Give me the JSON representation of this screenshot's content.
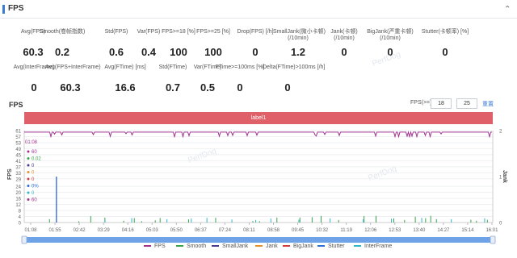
{
  "header": {
    "title": "FPS"
  },
  "stats_row1": [
    {
      "label": "Avg(FPS)",
      "value": "60.3"
    },
    {
      "label": "Smooth(卷帧指数)",
      "value": "0.2"
    },
    {
      "label": "Std(FPS)",
      "value": "0.6"
    },
    {
      "label": "Var(FPS)",
      "value": "0.4"
    },
    {
      "label": "FPS>=18 [%]",
      "value": "100"
    },
    {
      "label": "FPS>=25 [%]",
      "value": "100"
    },
    {
      "label": "Drop(FPS) [/h]",
      "value": "0"
    },
    {
      "label": "SmallJank(微小卡顿)",
      "label2": "(/10min)",
      "value": "1.2"
    },
    {
      "label": "Jank(卡顿)",
      "label2": "(/10min)",
      "value": "0"
    },
    {
      "label": "BigJank(严重卡顿)",
      "label2": "(/10min)",
      "value": "0"
    },
    {
      "label": "Stutter(卡顿率) [%]",
      "value": "0"
    }
  ],
  "stats_row2": [
    {
      "label": "Avg(InterFrame)",
      "value": "0"
    },
    {
      "label": "Avg(FPS+InterFrame)",
      "value": "60.3"
    },
    {
      "label": "Avg(FTime) [ms]",
      "value": "16.6"
    },
    {
      "label": "Std(FTime)",
      "value": "0.7"
    },
    {
      "label": "Var(FTime)",
      "value": "0.5"
    },
    {
      "label": "FTime>=100ms [%]",
      "value": "0"
    },
    {
      "label": "Delta(FTime)>100ms [/h]",
      "value": "0"
    }
  ],
  "watermark": "PerfDog",
  "chart": {
    "title": "FPS",
    "fps_filter_label": "FPS(>=)",
    "fps_filter_values": [
      "18",
      "25"
    ],
    "reset_label": "重置",
    "label_bar": "label1",
    "y_left_label": "FPS",
    "y_right_label": "Jank",
    "y_left_ticks": [
      "61",
      "57",
      "53",
      "49",
      "45",
      "41",
      "37",
      "33",
      "29",
      "24",
      "20",
      "16",
      "12",
      "8",
      "4",
      "0"
    ],
    "y_right_ticks": [
      "2",
      "1",
      "0"
    ],
    "x_ticks": [
      "01:08",
      "01:55",
      "02:42",
      "03:29",
      "04:16",
      "05:03",
      "05:50",
      "06:37",
      "07:24",
      "08:11",
      "08:58",
      "09:45",
      "10:32",
      "11:19",
      "12:06",
      "12:53",
      "13:40",
      "14:27",
      "15:14",
      "16:01"
    ],
    "tooltip_header": "01:08",
    "tooltip_lines": [
      "60",
      "0.02",
      "0",
      "0",
      "0",
      "0%",
      "0",
      "60"
    ],
    "tooltip_colors": [
      "#a0318f",
      "#37a34a",
      "#4a3b8f",
      "#e8912c",
      "#d23c3c",
      "#2d6fd8",
      "#2fb6c9",
      "#a0318f"
    ]
  },
  "legend": [
    {
      "name": "FPS",
      "color": "#a0318f"
    },
    {
      "name": "Smooth",
      "color": "#37a34a"
    },
    {
      "name": "SmallJank",
      "color": "#4a3b8f"
    },
    {
      "name": "Jank",
      "color": "#e8912c"
    },
    {
      "name": "BigJank",
      "color": "#d23c3c"
    },
    {
      "name": "Stutter",
      "color": "#2d6fd8"
    },
    {
      "name": "InterFrame",
      "color": "#2fb6c9"
    }
  ],
  "chart_data": {
    "type": "line",
    "x_range": [
      "01:08",
      "16:34"
    ],
    "ylim": [
      0,
      61
    ],
    "y2lim": [
      0,
      2
    ],
    "series": [
      {
        "name": "FPS",
        "values_summary": {
          "typical": 60,
          "min": 57
        }
      },
      {
        "name": "Smooth",
        "values_summary": {
          "typical": 0.02,
          "max": 4
        }
      },
      {
        "name": "SmallJank",
        "values_summary": {
          "typical": 0,
          "max": 1,
          "spike_at": "01:58"
        }
      },
      {
        "name": "Jank",
        "values_summary": {
          "typical": 0
        }
      },
      {
        "name": "BigJank",
        "values_summary": {
          "typical": 0
        }
      },
      {
        "name": "Stutter",
        "values_summary": {
          "typical": 0
        }
      },
      {
        "name": "InterFrame",
        "values_summary": {
          "typical": 0
        }
      }
    ],
    "grid": true,
    "legend_position": "bottom"
  }
}
